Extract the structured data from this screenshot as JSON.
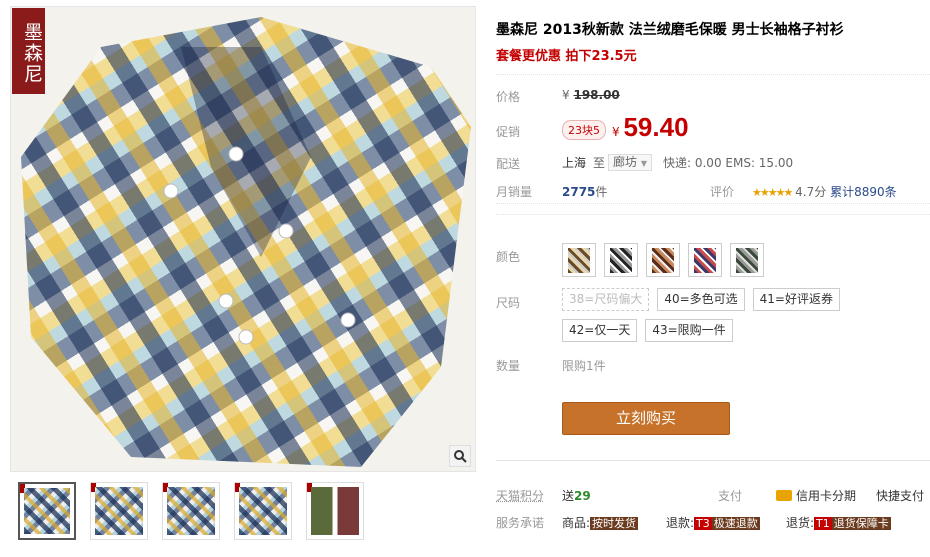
{
  "brand_tag": "墨森尼",
  "product": {
    "title": "墨森尼 2013秋新款 法兰绒磨毛保暖 男士长袖格子衬衫",
    "subtitle": "套餐更优惠 拍下23.5元"
  },
  "price": {
    "label": "价格",
    "currency": "¥",
    "original": "198.00"
  },
  "promo": {
    "label": "促销",
    "badge": "23块5",
    "currency": "¥",
    "price": "59.40"
  },
  "shipping": {
    "label": "配送",
    "from": "上海",
    "to_word": "至",
    "destination": "廊坊",
    "fees": "快递: 0.00 EMS: 15.00"
  },
  "sales": {
    "label": "月销量",
    "count": "2775",
    "unit": "件",
    "rating_label": "评价",
    "stars": "★★★★★",
    "score": "4.7分",
    "reviews": "累计8890条"
  },
  "color": {
    "label": "颜色",
    "swatches": 5
  },
  "size": {
    "label": "尺码",
    "options": [
      "38=尺码偏大",
      "40=多色可选",
      "41=好评返券",
      "42=仅一天",
      "43=限购一件"
    ]
  },
  "quantity": {
    "label": "数量",
    "limit": "限购1件"
  },
  "buy_button": "立刻购买",
  "points": {
    "label": "天猫积分",
    "value_prefix": "送",
    "value": "29",
    "pay_label": "支付",
    "card": "信用卡分期",
    "fast_pay": "快捷支付"
  },
  "service": {
    "label": "服务承诺",
    "item1_prefix": "商品:",
    "item1_tag": "按时发货",
    "item2_prefix": "退款:",
    "item2_code": "T3",
    "item2_tag": "极速退款",
    "item3_prefix": "退货:",
    "item3_code": "T1",
    "item3_tag": "退货保障卡"
  },
  "colors": {
    "accent": "#c40000",
    "buy": "#c6722b",
    "brand_tag": "#8b1a1a"
  }
}
